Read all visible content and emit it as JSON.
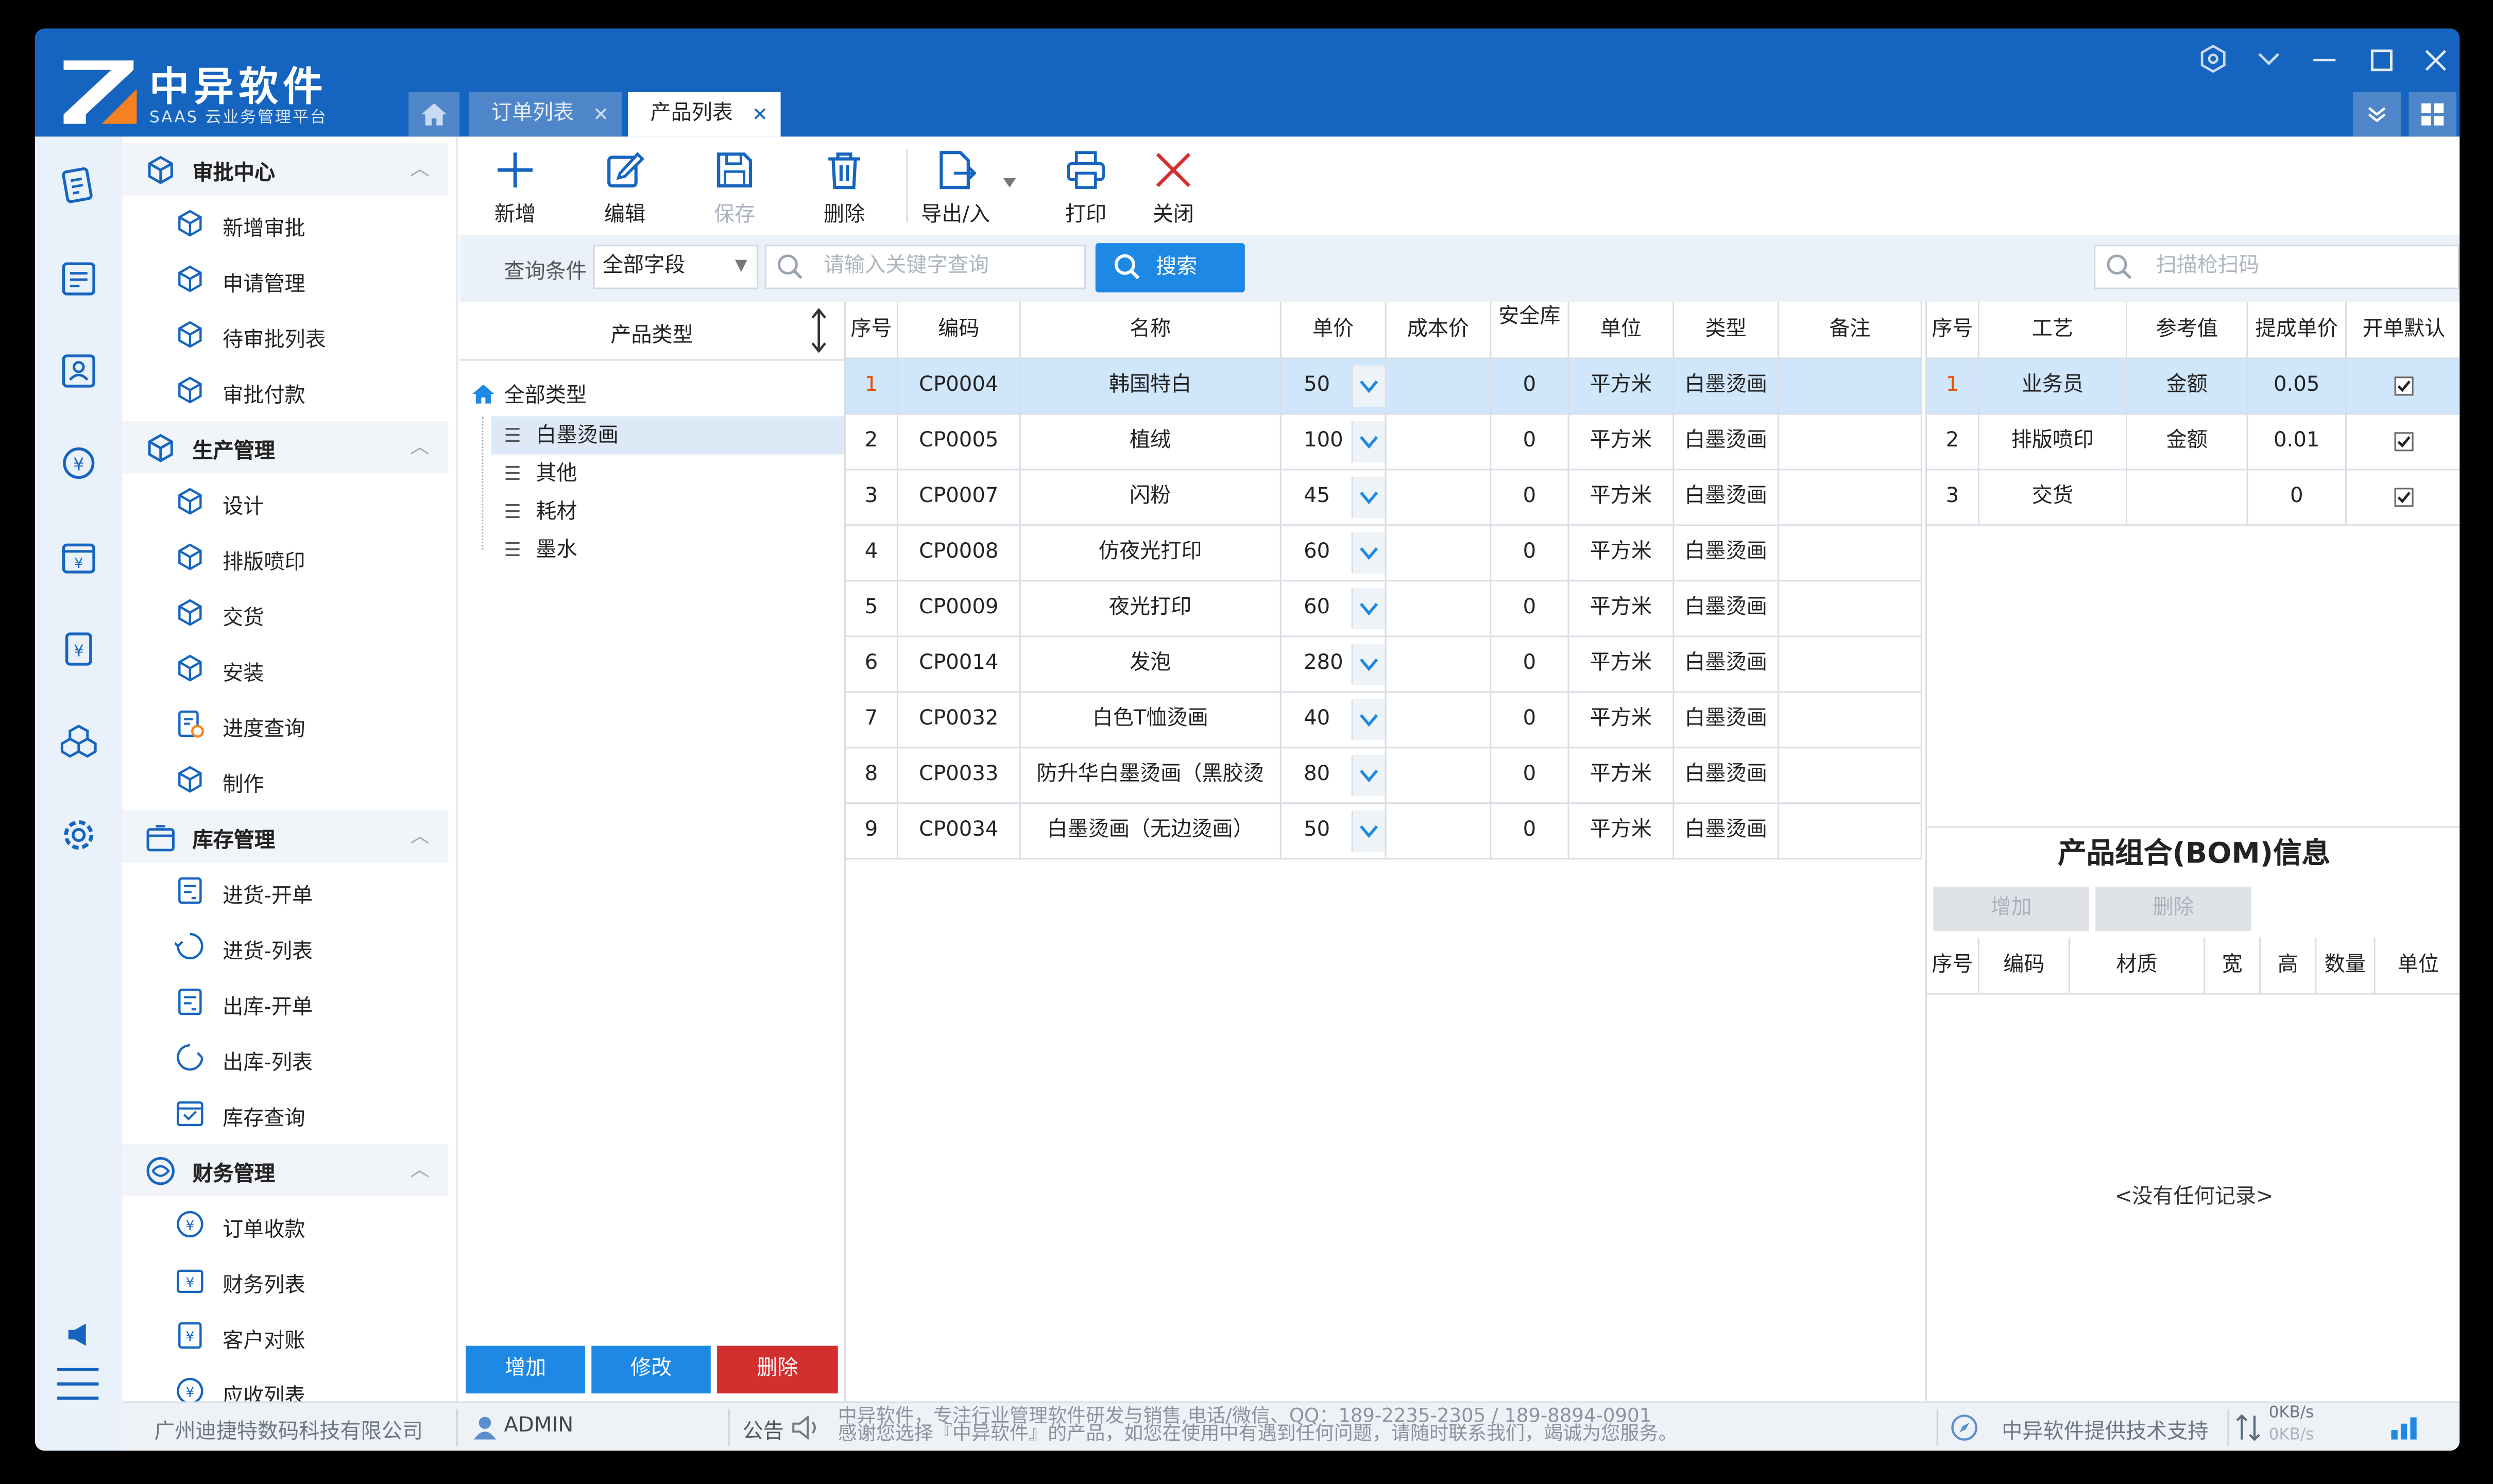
{
  "app": {
    "name": "中异软件",
    "subtitle": "SAAS 云业务管理平台"
  },
  "tabs": [
    {
      "label": "订单列表",
      "active": false
    },
    {
      "label": "产品列表",
      "active": true
    }
  ],
  "menu": {
    "groups": [
      {
        "title": "审批中心",
        "items": [
          "新增审批",
          "申请管理",
          "待审批列表",
          "审批付款"
        ]
      },
      {
        "title": "生产管理",
        "items": [
          "设计",
          "排版喷印",
          "交货",
          "安装",
          "进度查询",
          "制作"
        ]
      },
      {
        "title": "库存管理",
        "items": [
          "进货-开单",
          "进货-列表",
          "出库-开单",
          "出库-列表",
          "库存查询"
        ]
      },
      {
        "title": "财务管理",
        "items": [
          "订单收款",
          "财务列表",
          "客户对账",
          "应收列表"
        ]
      }
    ]
  },
  "toolbar": {
    "add": "新增",
    "edit": "编辑",
    "save": "保存",
    "delete": "删除",
    "export": "导出/入",
    "print": "打印",
    "close": "关闭"
  },
  "search": {
    "condition_label": "查询条件",
    "field_value": "全部字段",
    "placeholder": "请输入关键字查询",
    "button": "搜索",
    "scan_placeholder": "扫描枪扫码"
  },
  "tree": {
    "header": "产品类型",
    "root": "全部类型",
    "children": [
      "白墨烫画",
      "其他",
      "耗材",
      "墨水"
    ],
    "selected": "白墨烫画",
    "buttons": {
      "add": "增加",
      "modify": "修改",
      "delete": "删除"
    }
  },
  "products": {
    "columns": [
      "序号",
      "编码",
      "名称",
      "单价",
      "成本价",
      "安全库",
      "单位",
      "类型",
      "备注"
    ],
    "rows": [
      {
        "no": "1",
        "code": "CP0004",
        "name": "韩国特白",
        "price": "50",
        "cost": "",
        "safety": "0",
        "unit": "平方米",
        "type": "白墨烫画",
        "note": ""
      },
      {
        "no": "2",
        "code": "CP0005",
        "name": "植绒",
        "price": "100",
        "cost": "",
        "safety": "0",
        "unit": "平方米",
        "type": "白墨烫画",
        "note": ""
      },
      {
        "no": "3",
        "code": "CP0007",
        "name": "闪粉",
        "price": "45",
        "cost": "",
        "safety": "0",
        "unit": "平方米",
        "type": "白墨烫画",
        "note": ""
      },
      {
        "no": "4",
        "code": "CP0008",
        "name": "仿夜光打印",
        "price": "60",
        "cost": "",
        "safety": "0",
        "unit": "平方米",
        "type": "白墨烫画",
        "note": ""
      },
      {
        "no": "5",
        "code": "CP0009",
        "name": "夜光打印",
        "price": "60",
        "cost": "",
        "safety": "0",
        "unit": "平方米",
        "type": "白墨烫画",
        "note": ""
      },
      {
        "no": "6",
        "code": "CP0014",
        "name": "发泡",
        "price": "280",
        "cost": "",
        "safety": "0",
        "unit": "平方米",
        "type": "白墨烫画",
        "note": ""
      },
      {
        "no": "7",
        "code": "CP0032",
        "name": "白色T恤烫画",
        "price": "40",
        "cost": "",
        "safety": "0",
        "unit": "平方米",
        "type": "白墨烫画",
        "note": ""
      },
      {
        "no": "8",
        "code": "CP0033",
        "name": "防升华白墨烫画（黑胶烫",
        "price": "80",
        "cost": "",
        "safety": "0",
        "unit": "平方米",
        "type": "白墨烫画",
        "note": ""
      },
      {
        "no": "9",
        "code": "CP0034",
        "name": "白墨烫画（无边烫画）",
        "price": "50",
        "cost": "",
        "safety": "0",
        "unit": "平方米",
        "type": "白墨烫画",
        "note": ""
      }
    ],
    "selected_row": 1
  },
  "process": {
    "columns": [
      "序号",
      "工艺",
      "参考值",
      "提成单价",
      "开单默认"
    ],
    "rows": [
      {
        "no": "1",
        "process": "业务员",
        "ref": "金额",
        "commission": "0.05",
        "default": true
      },
      {
        "no": "2",
        "process": "排版喷印",
        "ref": "金额",
        "commission": "0.01",
        "default": true
      },
      {
        "no": "3",
        "process": "交货",
        "ref": "",
        "commission": "0",
        "default": true
      }
    ]
  },
  "bom": {
    "title": "产品组合(BOM)信息",
    "add": "增加",
    "delete": "删除",
    "columns": [
      "序号",
      "编码",
      "材质",
      "宽",
      "高",
      "数量",
      "单位"
    ],
    "empty": "<没有任何记录>"
  },
  "status": {
    "company": "广州迪捷特数码科技有限公司",
    "user": "ADMIN",
    "notice_label": "公告",
    "notice_line1": "中异软件，专注行业管理软件研发与销售,电话/微信、QQ：189-2235-2305 / 189-8894-0901",
    "notice_line2": "感谢您选择『中异软件』的产品，如您在使用中有遇到任何问题，请随时联系我们，竭诚为您服务。",
    "support": "中异软件提供技术支持",
    "up": "0KB/s",
    "down": "0KB/s"
  },
  "colors": {
    "brand": "#1565c0",
    "accent": "#1e88e5",
    "danger": "#d32f2f",
    "selected": "#cfe6fb"
  }
}
